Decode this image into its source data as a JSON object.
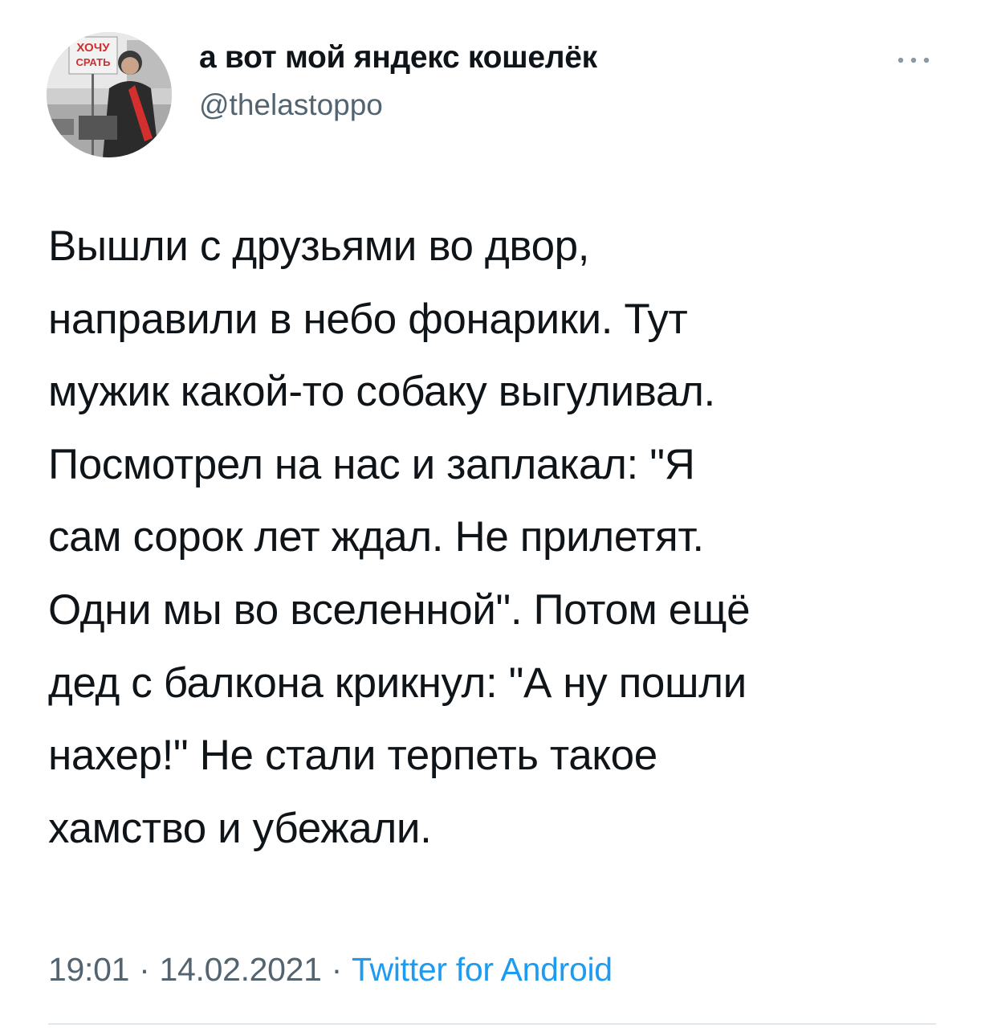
{
  "author": {
    "display_name": "а вот мой яндекс кошелёк",
    "handle": "@thelastoppo",
    "avatar_sign_text": "ХОЧУ СРАТЬ"
  },
  "more_icon": "more-dots-icon",
  "tweet": {
    "lines": [
      "Вышли с друзьями во двор,",
      "направили в небо фонарики. Тут",
      "мужик какой-то собаку выгуливал.",
      "Посмотрел на нас и заплакал: \"Я",
      "сам сорок лет ждал. Не прилетят.",
      "Одни мы во вселенной\". Потом ещё",
      "дед с балкона крикнул: \"А ну пошли",
      "нахер!\" Не стали терпеть такое",
      "хамство и убежали."
    ]
  },
  "meta": {
    "time": "19:01",
    "separator": "·",
    "date": "14.02.2021",
    "source": "Twitter for Android"
  },
  "colors": {
    "text": "#0f1419",
    "secondary": "#536471",
    "link": "#1d9bf0",
    "divider": "#e1e8ed"
  }
}
